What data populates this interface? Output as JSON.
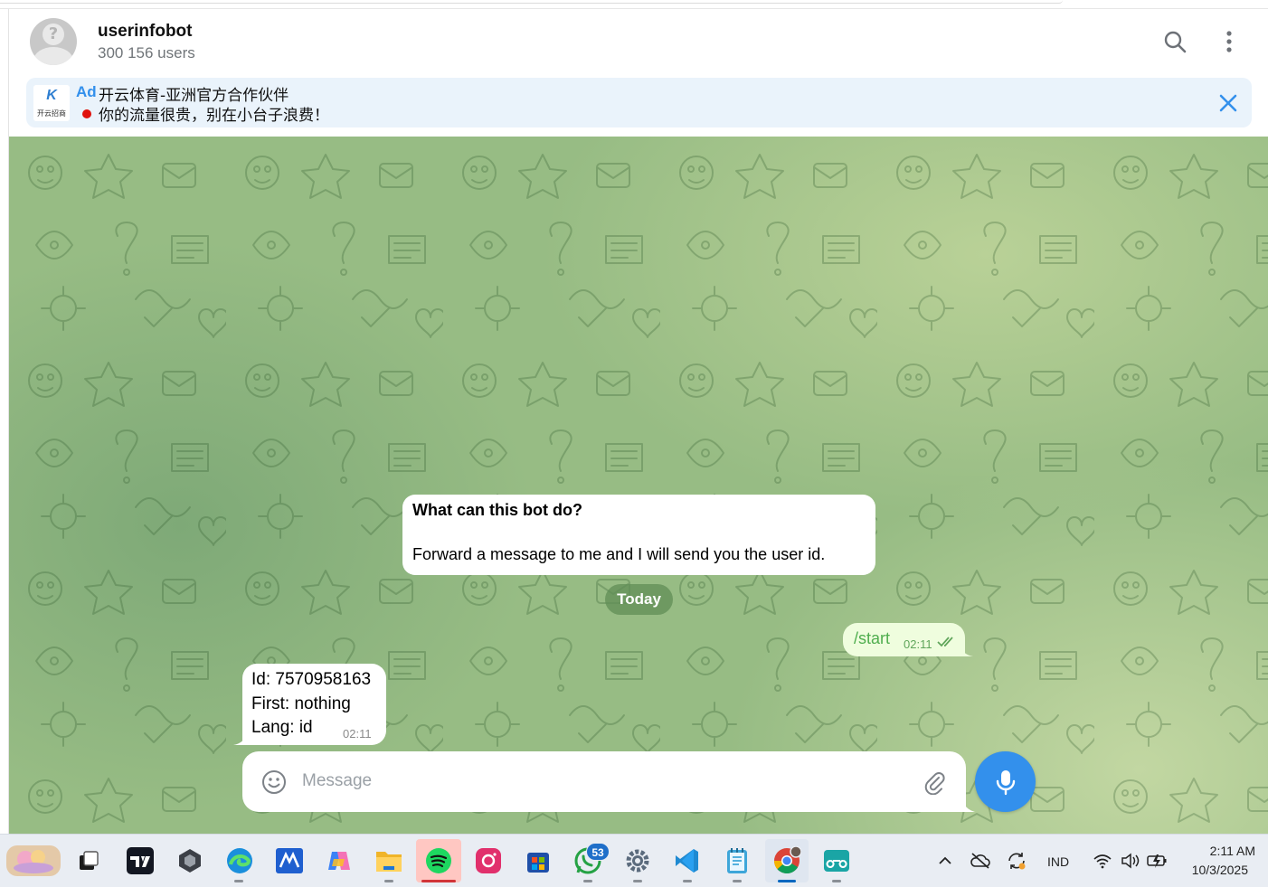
{
  "colors": {
    "accent": "#3390ec",
    "outgoing_bubble": "#effdde",
    "ad_bg": "#eaf3fb",
    "chat_bg": "#97bc84"
  },
  "header": {
    "title": "userinfobot",
    "subtitle": "300 156 users",
    "avatar_icon": "user-placeholder-icon",
    "actions": [
      {
        "icon": "search-icon"
      },
      {
        "icon": "more-vertical-icon"
      }
    ]
  },
  "ad": {
    "tag": "Ad",
    "logo_letter": "K",
    "logo_text": "开云招商",
    "line1": "开云体育-亚洲官方合作伙伴",
    "line2": "你的流量很贵，别在小台子浪费！",
    "close_icon": "close-icon"
  },
  "bot_info": {
    "question": "What can this bot do?",
    "answer": "Forward a message to me and I will send you the user id."
  },
  "date_chip": "Today",
  "messages": [
    {
      "direction": "out",
      "text": "/start",
      "time": "02:11",
      "status": "read"
    },
    {
      "direction": "in",
      "lines": [
        "Id: 7570958163",
        "First: nothing",
        "Lang: id"
      ],
      "time": "02:11"
    }
  ],
  "composer": {
    "placeholder": "Message",
    "value": "",
    "emoji_icon": "emoji-icon",
    "attach_icon": "paperclip-icon",
    "send_icon": "microphone-icon"
  },
  "taskbar": {
    "apps": [
      {
        "name": "widgets",
        "icon": "weather-widget-icon"
      },
      {
        "name": "task-view",
        "icon": "task-view-icon"
      },
      {
        "name": "tradingview",
        "icon": "tradingview-icon"
      },
      {
        "name": "unknown-app",
        "icon": "cube-app-icon"
      },
      {
        "name": "edge",
        "icon": "edge-icon"
      },
      {
        "name": "app-m",
        "icon": "m-app-icon"
      },
      {
        "name": "copilot",
        "icon": "copilot-icon"
      },
      {
        "name": "file-explorer",
        "icon": "folder-icon"
      },
      {
        "name": "spotify",
        "icon": "spotify-icon"
      },
      {
        "name": "instagram",
        "icon": "instagram-icon"
      },
      {
        "name": "store",
        "icon": "store-icon"
      },
      {
        "name": "whatsapp",
        "icon": "whatsapp-icon",
        "badge": "53"
      },
      {
        "name": "settings",
        "icon": "settings-icon"
      },
      {
        "name": "vscode",
        "icon": "vscode-icon"
      },
      {
        "name": "notepad",
        "icon": "notepad-icon"
      },
      {
        "name": "chrome",
        "icon": "chrome-icon"
      },
      {
        "name": "arduino",
        "icon": "arduino-icon"
      }
    ],
    "tray": {
      "chevron_icon": "chevron-up-icon",
      "onedrive_icon": "cloud-offline-icon",
      "sync_icon": "sync-icon",
      "language": "IND",
      "wifi_icon": "wifi-icon",
      "volume_icon": "volume-icon",
      "battery_icon": "battery-charging-icon"
    },
    "clock": {
      "time": "2:11 AM",
      "date": "10/3/2025"
    }
  }
}
